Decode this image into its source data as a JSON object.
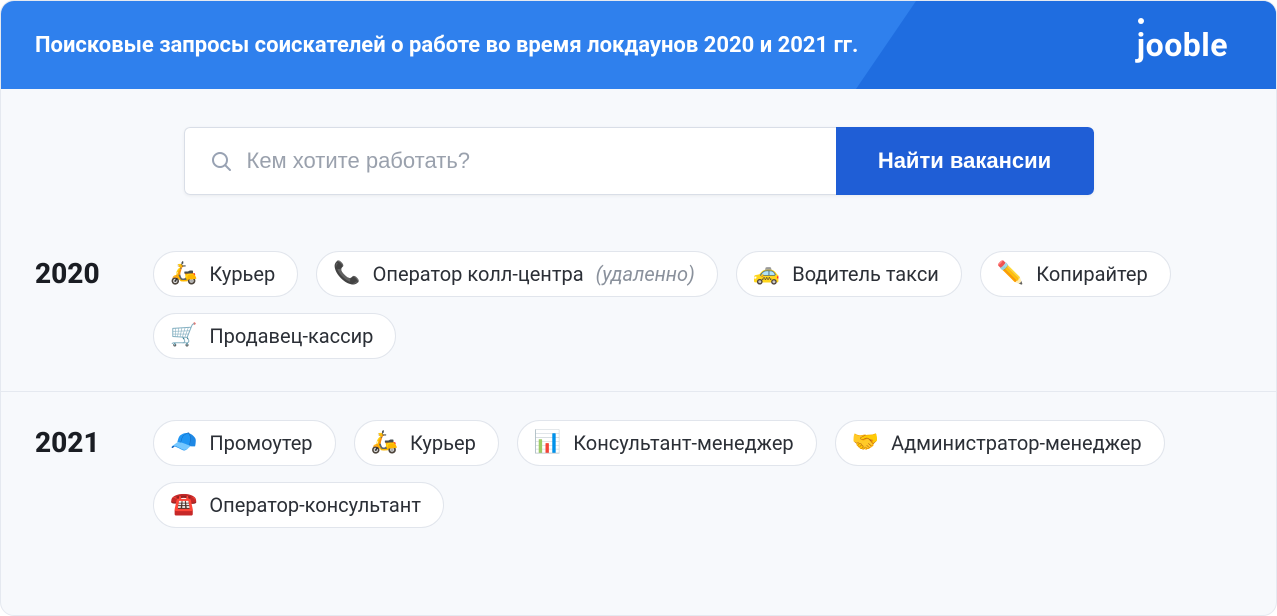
{
  "header": {
    "title": "Поисковые запросы соискателей о работе во время локдаунов 2020 и 2021 гг.",
    "brand": "ooble",
    "brand_j": "j"
  },
  "search": {
    "placeholder": "Кем хотите работать?",
    "button": "Найти вакансии"
  },
  "years": [
    {
      "label": "2020",
      "items": [
        {
          "emoji": "🛵",
          "text": "Курьер"
        },
        {
          "emoji": "📞",
          "text": "Оператор колл-центра",
          "suffix": "(удаленно)"
        },
        {
          "emoji": "🚕",
          "text": "Водитель такси"
        },
        {
          "emoji": "✏️",
          "text": "Копирайтер"
        },
        {
          "emoji": "🛒",
          "text": "Продавец-кассир"
        }
      ]
    },
    {
      "label": "2021",
      "items": [
        {
          "emoji": "🧢",
          "text": "Промоутер"
        },
        {
          "emoji": "🛵",
          "text": "Курьер"
        },
        {
          "emoji": "📊",
          "text": "Консультант-менеджер"
        },
        {
          "emoji": "🤝",
          "text": "Администратор-менеджер"
        },
        {
          "emoji": "☎️",
          "text": "Оператор-консультант"
        }
      ]
    }
  ]
}
